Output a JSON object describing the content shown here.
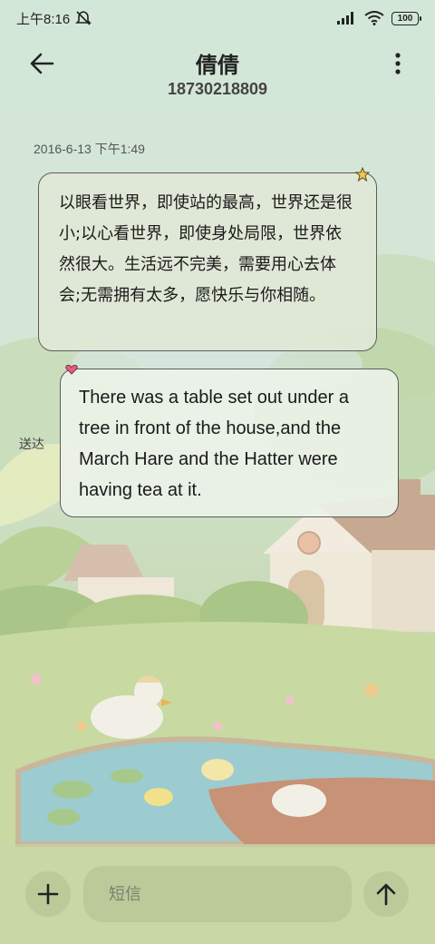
{
  "status_bar": {
    "time": "上午8:16",
    "battery": "100",
    "icons": [
      "mute-bell-icon",
      "signal-icon",
      "wifi-icon",
      "battery-icon"
    ]
  },
  "header": {
    "contact_name": "倩倩",
    "contact_number": "18730218809",
    "back_icon": "arrow-left-icon",
    "menu_icon": "more-vertical-icon"
  },
  "conversation": {
    "timestamp": "2016-6-13 下午1:49",
    "messages": [
      {
        "direction": "received",
        "text": "以眼看世界，即使站的最高，世界还是很小;以心看世界，即使身处局限，世界依然很大。生活远不完美，需要用心去体会;无需拥有太多，愿快乐与你相随。",
        "badge_icon": "star-icon"
      },
      {
        "direction": "sent",
        "text": "There was a table set out under a tree in front of the house,and the March Hare and the Hatter were having tea at it.",
        "badge_icon": "heart-icon",
        "status": "送达"
      }
    ]
  },
  "composer": {
    "placeholder": "短信",
    "add_icon": "plus-icon",
    "send_icon": "arrow-up-icon"
  },
  "colors": {
    "background": "#d3e7d8",
    "bubble_border": "#5c5c5c",
    "star": "#f2c94c",
    "heart": "#e85a8a"
  }
}
